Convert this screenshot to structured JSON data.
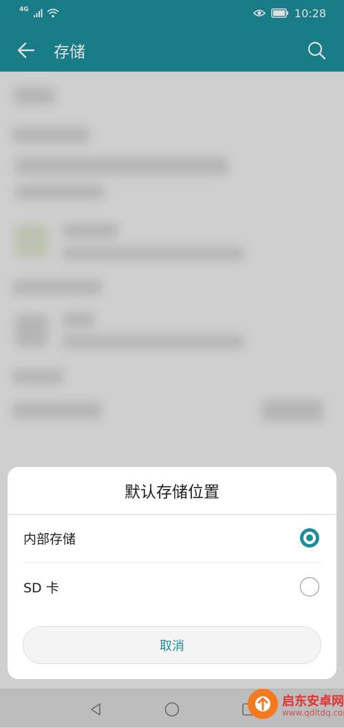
{
  "status_bar": {
    "network": "4G",
    "time": "10:28"
  },
  "app_bar": {
    "title": "存储"
  },
  "dialog": {
    "title": "默认存储位置",
    "options": [
      {
        "label": "内部存储",
        "selected": true
      },
      {
        "label": "SD 卡",
        "selected": false
      }
    ],
    "cancel_label": "取消"
  },
  "watermark": {
    "name": "启东安卓网",
    "url": "www.qdltdq.com"
  },
  "colors": {
    "accent": "#1b8e98",
    "watermark": "#e0312f"
  },
  "icons": {
    "status": [
      "signal-icon",
      "wifi-icon",
      "eye-icon",
      "battery-icon"
    ],
    "app_bar": [
      "back-arrow-icon",
      "search-icon"
    ],
    "nav": [
      "nav-back-icon",
      "nav-home-icon",
      "nav-recents-icon"
    ]
  }
}
